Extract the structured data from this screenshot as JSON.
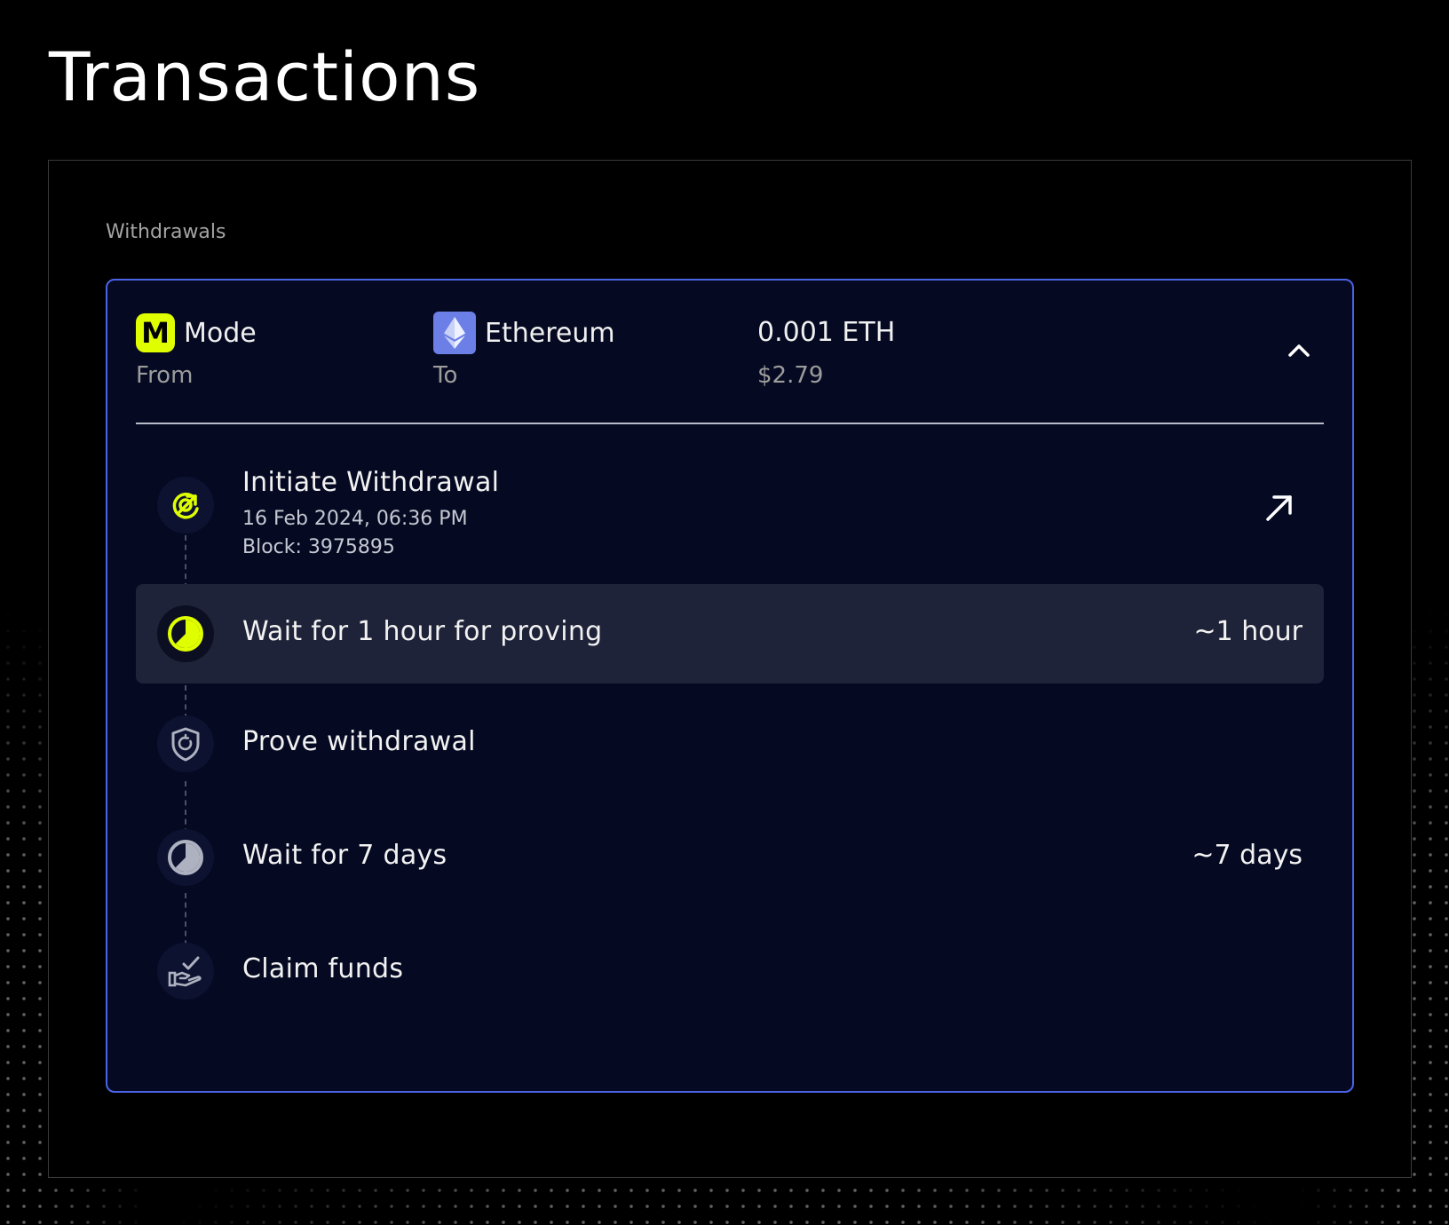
{
  "page": {
    "title": "Transactions"
  },
  "withdrawals": {
    "section_label": "Withdrawals",
    "transaction": {
      "from": {
        "chain": "Mode",
        "label": "From",
        "logo_letter": "M",
        "logo_color": "#dffe00"
      },
      "to": {
        "chain": "Ethereum",
        "label": "To",
        "logo_color": "#6b7fe6"
      },
      "amount": {
        "value": "0.001 ETH",
        "usd": "$2.79"
      },
      "expanded": true,
      "steps": [
        {
          "title": "Initiate Withdrawal",
          "date": "16 Feb 2024, 06:36 PM",
          "block": "Block: 3975895",
          "icon": "arrow-target-icon",
          "status": "completed",
          "has_link": true
        },
        {
          "title": "Wait for 1 hour for proving",
          "duration": "~1 hour",
          "icon": "clock-pie-icon",
          "status": "active"
        },
        {
          "title": "Prove withdrawal",
          "icon": "shield-icon",
          "status": "pending"
        },
        {
          "title": "Wait for 7 days",
          "duration": "~7 days",
          "icon": "clock-pie-icon",
          "status": "pending"
        },
        {
          "title": "Claim funds",
          "icon": "hand-check-icon",
          "status": "pending"
        }
      ]
    }
  },
  "colors": {
    "accent_border": "#4c63e6",
    "active_yellow": "#dffe00",
    "card_bg": "#050a22",
    "active_row_bg": "#1f2339"
  }
}
